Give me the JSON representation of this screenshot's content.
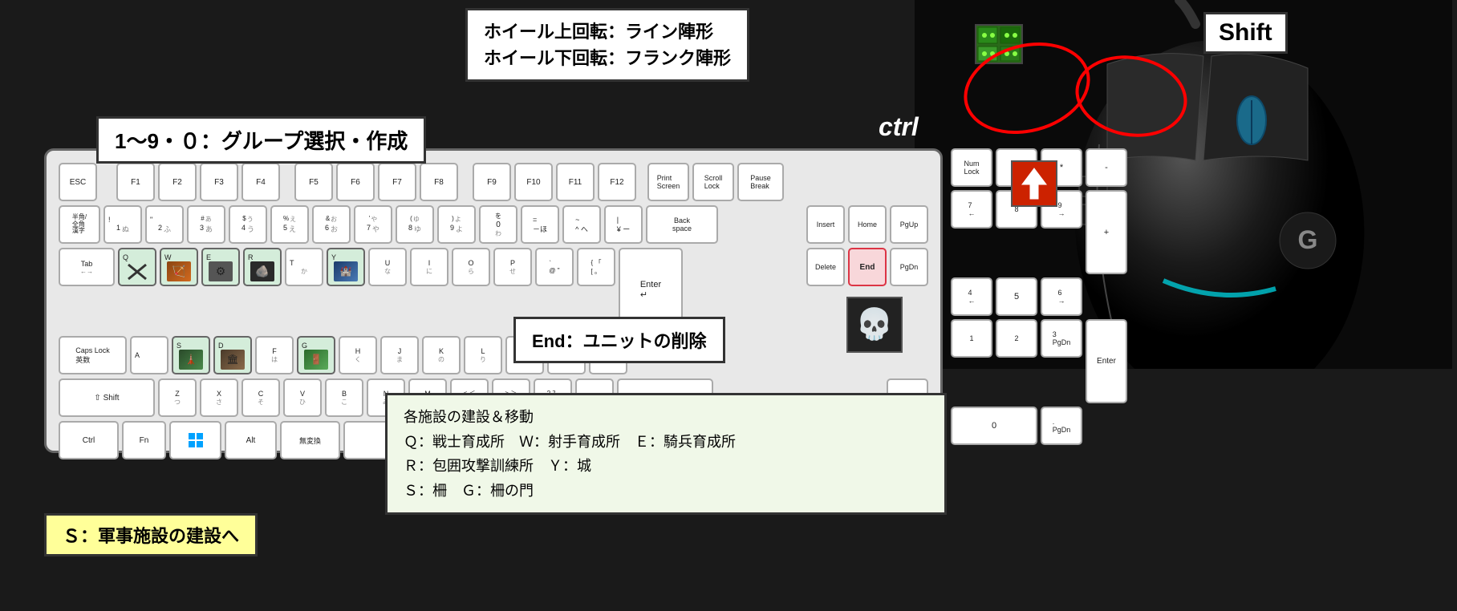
{
  "wheel_info": {
    "line1": "ホイール上回転：ライン陣形",
    "line2": "ホイール下回転：フランク陣形"
  },
  "group_select": {
    "text": "1～9・０：グループ選択・作成"
  },
  "end_info": {
    "text": "End：ユニットの削除"
  },
  "building_info": {
    "line1": "各施設の建設＆移動",
    "line2": "Ｑ：戦士育成所　Ｗ：射手育成所　Ｅ：騎兵育成所",
    "line3": "Ｒ：包囲攻撃訓練所　Ｙ：城",
    "line4": "Ｓ：柵　Ｇ：柵の門"
  },
  "military_info": {
    "text": "Ｓ：軍事施設の建設へ"
  },
  "ctrl_label": "ctrl",
  "shift_label": "Shift",
  "keyboard": {
    "row1": [
      "ESC",
      "F1",
      "F2",
      "F3",
      "F4",
      "F5",
      "F6",
      "F7",
      "F8",
      "F9",
      "F10",
      "F11",
      "F12",
      "Print Screen",
      "Scroll Lock",
      "Pause Break"
    ],
    "backspace": "Back space"
  }
}
